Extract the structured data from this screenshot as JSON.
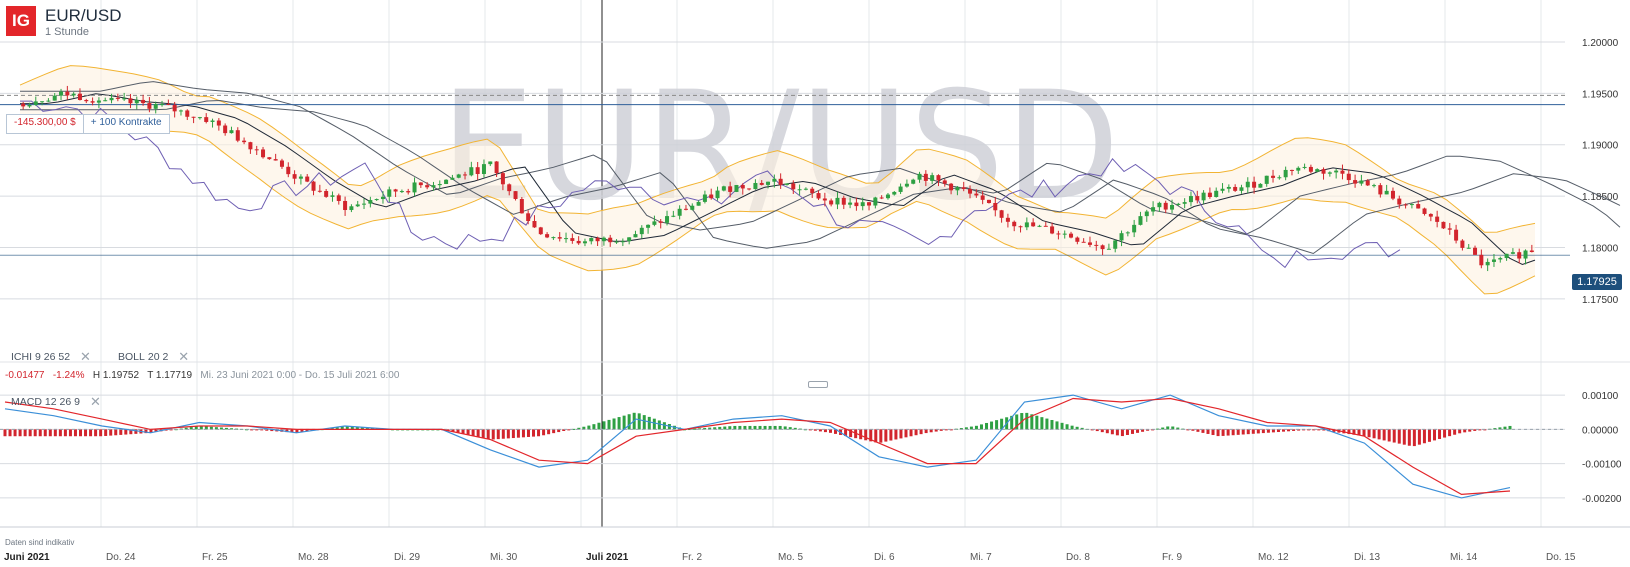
{
  "header": {
    "logo": "IG",
    "symbol": "EUR/USD",
    "timeframe": "1 Stunde",
    "watermark": "EUR/USD"
  },
  "position": {
    "pnl": "-145.300,00 $",
    "quantity": "+ 100 Kontrakte"
  },
  "indicators": [
    {
      "name": "ICHI",
      "params": "9  26  52"
    },
    {
      "name": "BOLL",
      "params": "20  2"
    }
  ],
  "stats": {
    "change": "-0.01477",
    "change_pct": "-1.24%",
    "high_label": "H",
    "high": "1.19752",
    "low_label": "T",
    "low": "1.17719",
    "range": "Mi. 23 Juni 2021 0:00 - Do. 15 Juli 2021 6:00"
  },
  "macd_indicator": {
    "name": "MACD",
    "params": "12  26  9"
  },
  "footer_note": "Daten sind indikativ",
  "current_price": "1.17925",
  "colors": {
    "up": "#2ea043",
    "down": "#d2252d",
    "ichimoku": "#6e5fb3",
    "bollinger": "#f2b433",
    "baseline": "#1f2937",
    "macd_line": "#3b8fd8",
    "signal_line": "#e2262b",
    "price_tag": "#1d4f7c"
  },
  "chart_data": [
    {
      "type": "line",
      "title": "EUR/USD",
      "subtitle": "1 Stunde",
      "x": [
        "Juni 2021",
        "Do. 24",
        "Fr. 25",
        "Mo. 28",
        "Di. 29",
        "Mi. 30",
        "Juli 2021",
        "Fr. 2",
        "Mo. 5",
        "Di. 6",
        "Mi. 7",
        "Do. 8",
        "Fr. 9",
        "Mo. 12",
        "Di. 13",
        "Mi. 14",
        "Do. 15"
      ],
      "y_ticks": [
        "1.17500",
        "1.18000",
        "1.18500",
        "1.19000",
        "1.19500",
        "1.20000"
      ],
      "ylim": [
        1.171,
        1.2035
      ],
      "series": [
        {
          "name": "EUR/USD",
          "values": [
            1.194,
            1.195,
            1.1942,
            1.1938,
            1.1925,
            1.1898,
            1.1865,
            1.1838,
            1.1855,
            1.1865,
            1.188,
            1.1815,
            1.1805,
            1.1812,
            1.1835,
            1.1858,
            1.1865,
            1.1848,
            1.184,
            1.1872,
            1.1855,
            1.1825,
            1.1815,
            1.18,
            1.1838,
            1.185,
            1.186,
            1.1878,
            1.1872,
            1.185,
            1.1825,
            1.1782,
            1.1798
          ]
        }
      ],
      "current_price": 1.17925,
      "position_price": 1.1939
    },
    {
      "type": "bar",
      "title": "MACD  12  26  9",
      "y_ticks": [
        "-0.00200",
        "-0.00100",
        "0.00000",
        "0.00100"
      ],
      "ylim": [
        -0.0025,
        0.0015
      ],
      "series": [
        {
          "name": "MACD",
          "values": [
            0.0006,
            0.0004,
            0.0001,
            -0.0001,
            0.0002,
            0.0001,
            -0.0001,
            0.0001,
            0.0,
            0.0,
            -0.0006,
            -0.0011,
            -0.0009,
            0.0003,
            0.0,
            0.0003,
            0.0004,
            0.0001,
            -0.0008,
            -0.0011,
            -0.0009,
            0.0008,
            0.001,
            0.0006,
            0.001,
            0.0004,
            0.0001,
            0.0001,
            -0.0004,
            -0.0016,
            -0.002,
            -0.0017
          ]
        },
        {
          "name": "Signal",
          "values": [
            0.0008,
            0.0006,
            0.0003,
            0.0,
            0.0001,
            0.0001,
            0.0,
            0.0,
            0.0,
            0.0,
            -0.0003,
            -0.0009,
            -0.001,
            -0.0002,
            0.0,
            0.0002,
            0.0003,
            0.0002,
            -0.0004,
            -0.001,
            -0.001,
            0.0003,
            0.0009,
            0.0008,
            0.0009,
            0.0006,
            0.0002,
            0.0001,
            -0.0002,
            -0.0011,
            -0.0019,
            -0.0018
          ]
        }
      ]
    }
  ]
}
